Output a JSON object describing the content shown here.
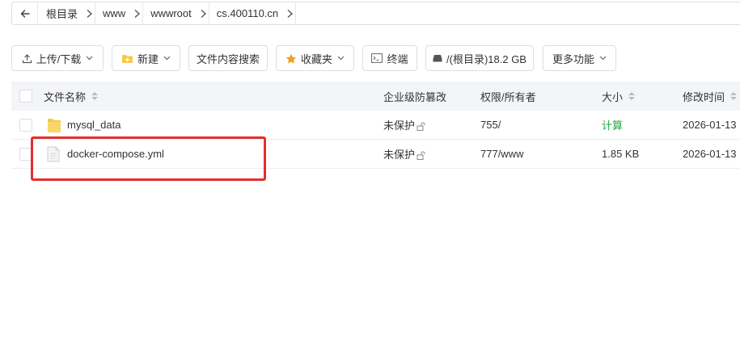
{
  "breadcrumb": {
    "items": [
      "根目录",
      "www",
      "wwwroot",
      "cs.400110.cn"
    ]
  },
  "toolbar": {
    "upload": "上传/下载",
    "new": "新建",
    "search_content": "文件内容搜索",
    "favorites": "收藏夹",
    "terminal": "终端",
    "disk": "/(根目录)18.2 GB",
    "more": "更多功能"
  },
  "table": {
    "columns": {
      "name": "文件名称",
      "protection": "企业级防篡改",
      "permission": "权限/所有者",
      "size": "大小",
      "modified": "修改时间"
    },
    "rows": [
      {
        "name": "mysql_data",
        "type": "folder",
        "protection": "未保护",
        "permission": "755/",
        "size": "计算",
        "modified": "2026-01-13"
      },
      {
        "name": "docker-compose.yml",
        "type": "file",
        "protection": "未保护",
        "permission": "777/www",
        "size": "1.85 KB",
        "modified": "2026-01-13"
      }
    ]
  },
  "colors": {
    "accent_green": "#20a53a",
    "highlight_red": "#e0312f",
    "folder_yellow": "#f7c94b"
  },
  "icons": {
    "back": "arrow-left-icon",
    "folder": "folder-icon",
    "file": "file-icon",
    "lock": "lock-icon"
  }
}
